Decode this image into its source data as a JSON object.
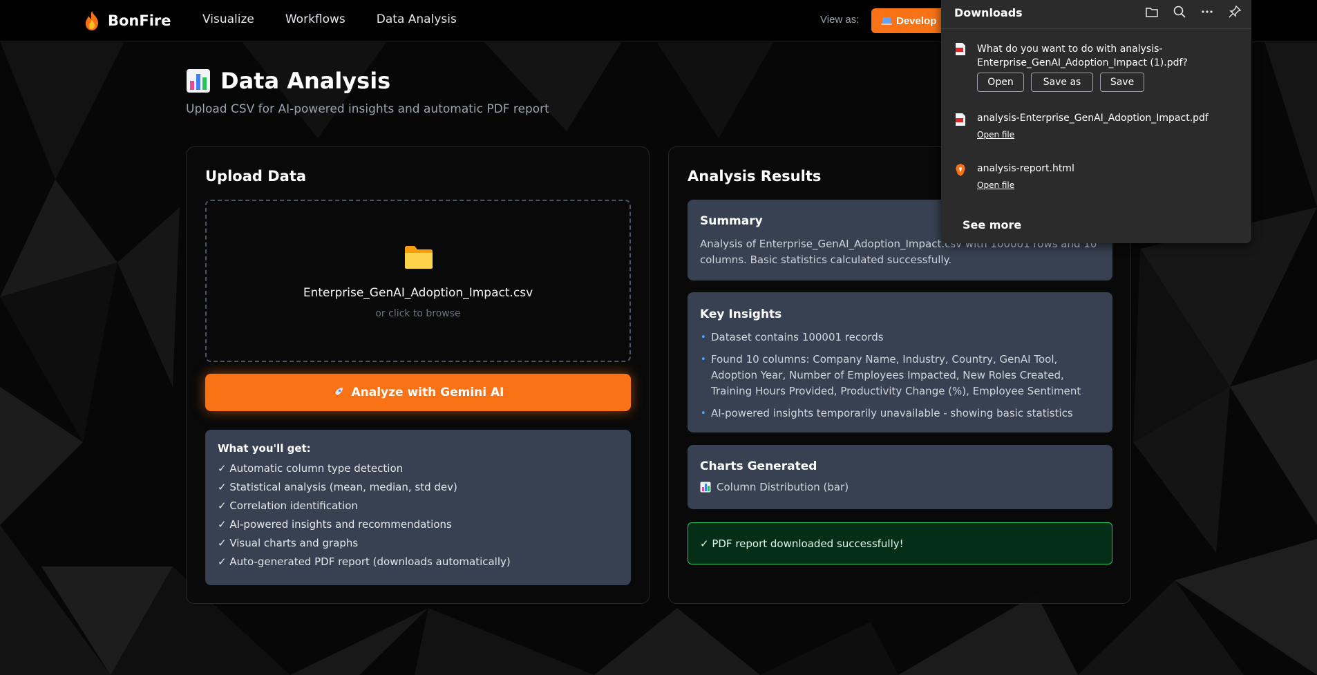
{
  "nav": {
    "brand": "BonFire",
    "links": [
      "Visualize",
      "Workflows",
      "Data Analysis"
    ],
    "view_as_label": "View as:",
    "view_as_value": "Develop"
  },
  "page": {
    "title": "Data Analysis",
    "subtitle": "Upload CSV for AI-powered insights and automatic PDF report"
  },
  "upload": {
    "title": "Upload Data",
    "file_name": "Enterprise_GenAI_Adoption_Impact.csv",
    "browse_hint": "or click to browse",
    "analyze_label": "Analyze with Gemini AI",
    "features_title": "What you'll get:",
    "features": [
      "✓ Automatic column type detection",
      "✓ Statistical analysis (mean, median, std dev)",
      "✓ Correlation identification",
      "✓ AI-powered insights and recommendations",
      "✓ Visual charts and graphs",
      "✓ Auto-generated PDF report (downloads automatically)"
    ]
  },
  "results": {
    "title": "Analysis Results",
    "summary_title": "Summary",
    "summary_text": "Analysis of Enterprise_GenAI_Adoption_Impact.csv with 100001 rows and 10 columns. Basic statistics calculated successfully.",
    "insights_title": "Key Insights",
    "insights": [
      "Dataset contains 100001 records",
      "Found 10 columns: Company Name, Industry, Country, GenAI Tool, Adoption Year, Number of Employees Impacted, New Roles Created, Training Hours Provided, Productivity Change (%), Employee Sentiment",
      "AI-powered insights temporarily unavailable - showing basic statistics"
    ],
    "charts_title": "Charts Generated",
    "charts": [
      "Column Distribution (bar)"
    ],
    "success_message": "✓ PDF report downloaded successfully!"
  },
  "downloads": {
    "title": "Downloads",
    "question": "What do you want to do with analysis-Enterprise_GenAI_Adoption_Impact (1).pdf?",
    "open_label": "Open",
    "save_as_label": "Save as",
    "save_label": "Save",
    "items": [
      {
        "name": "analysis-Enterprise_GenAI_Adoption_Impact.pdf",
        "action": "Open file"
      },
      {
        "name": "analysis-report.html",
        "action": "Open file"
      }
    ],
    "see_more": "See more"
  },
  "colors": {
    "accent": "#f97316",
    "card": "#374151",
    "success_border": "#22c55e",
    "bullet": "#60a5fa"
  },
  "icons": {
    "brand": "flame-icon",
    "title": "bar-chart-icon",
    "upload": "folder-icon",
    "analyze": "rocket-icon",
    "developer": "laptop-icon"
  }
}
